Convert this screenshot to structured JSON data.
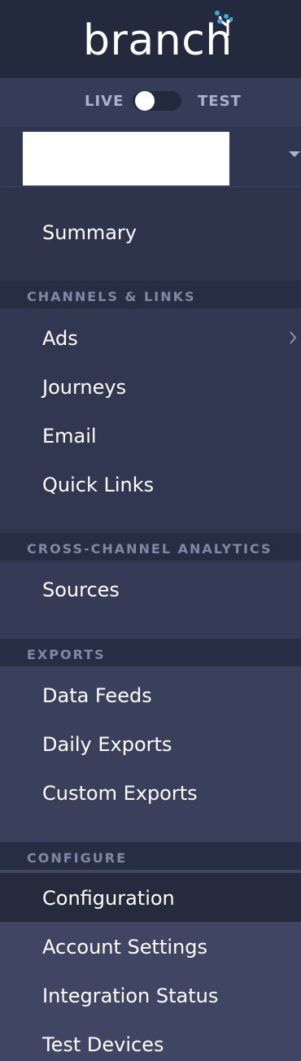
{
  "logo": {
    "text": "branch",
    "icon": "branch-tree-icon"
  },
  "environment": {
    "live_label": "LIVE",
    "test_label": "TEST",
    "mode": "live"
  },
  "app_selector": {
    "name": "",
    "caret_icon": "caret-down-icon"
  },
  "nav": {
    "summary": "Summary",
    "sections": [
      {
        "label": "CHANNELS & LINKS",
        "items": [
          "Ads",
          "Journeys",
          "Email",
          "Quick Links"
        ]
      },
      {
        "label": "CROSS-CHANNEL ANALYTICS",
        "items": [
          "Sources"
        ]
      },
      {
        "label": "EXPORTS",
        "items": [
          "Data Feeds",
          "Daily Exports",
          "Custom Exports"
        ]
      },
      {
        "label": "CONFIGURE",
        "items": [
          "Configuration",
          "Account Settings",
          "Integration Status",
          "Test Devices"
        ]
      }
    ],
    "active_item": "Configuration",
    "ads_submenu_icon": "chevron-right-icon"
  },
  "colors": {
    "sidebar_bg": "#2e344c",
    "header_bg": "#242a3e",
    "section_header_bg": "#272d43",
    "section_label": "#7e89a6",
    "active_item_bg": "#262a3d",
    "accent": "#3aa8e0"
  }
}
